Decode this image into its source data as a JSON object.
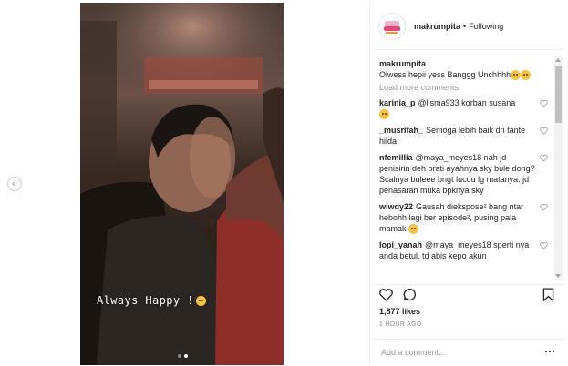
{
  "post": {
    "caption_overlay": "Always Happy !",
    "username": "makrumpita",
    "separator": "•",
    "follow_status": "Following",
    "caption_user": "makrumpita",
    "caption_dot": ".",
    "caption_text": "Olwess hepii yess Banggg Unchhhh",
    "load_more": "Load more comments",
    "likes": "1,877 likes",
    "time": "1 HOUR AGO",
    "add_comment_placeholder": "Add a comment..."
  },
  "carousel": {
    "total_slides": 2,
    "active_slide": 2
  },
  "comments": [
    {
      "user": "karinia_p",
      "text": "@lisma933 korban susana"
    },
    {
      "user": "_musrifah_",
      "text": "Semoga lebih baik dri tante hilda"
    },
    {
      "user": "nfemillia",
      "text": "@maya_meyes18 nah jd penisirin deh brati ayahnya sky bule dong? Scalnya buleee bngt lucuu lg matanya. jd penasaran muka bpknya sky"
    },
    {
      "user": "wiwdy22",
      "text": "Gausah diekspose² bang ntar hebohh lagi ber episode², pusing pala mamak"
    },
    {
      "user": "lopi_yanah",
      "text": "@maya_meyes18 sperti nya anda betul, td abis kepo akun"
    }
  ],
  "colors": {
    "text": "#262626",
    "muted": "#999999",
    "border": "#efefef",
    "avatar_accent": "#e8457a"
  },
  "icons": {
    "prev": "chevron-left-icon",
    "like": "heart-icon",
    "comment": "comment-bubble-icon",
    "save": "bookmark-icon",
    "more": "more-options-icon"
  }
}
